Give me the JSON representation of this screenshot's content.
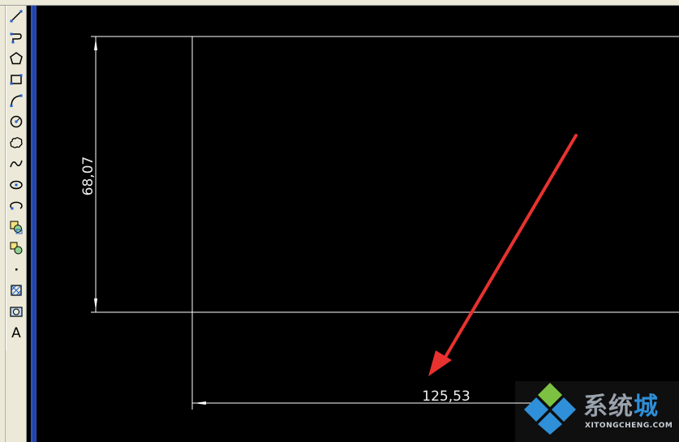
{
  "toolbar": {
    "tools": [
      {
        "name": "line-tool-icon"
      },
      {
        "name": "polyline-tool-icon"
      },
      {
        "name": "polygon-tool-icon"
      },
      {
        "name": "rectangle-tool-icon"
      },
      {
        "name": "arc-tool-icon"
      },
      {
        "name": "circle-tool-icon"
      },
      {
        "name": "revision-cloud-tool-icon"
      },
      {
        "name": "spline-tool-icon"
      },
      {
        "name": "ellipse-tool-icon"
      },
      {
        "name": "ellipse-arc-tool-icon"
      },
      {
        "name": "insert-block-tool-icon"
      },
      {
        "name": "make-block-tool-icon"
      },
      {
        "name": "point-tool-icon"
      },
      {
        "name": "hatch-tool-icon"
      },
      {
        "name": "region-tool-icon"
      },
      {
        "name": "multiline-text-tool-icon"
      }
    ],
    "text_tool_glyph": "A"
  },
  "drawing": {
    "vertical_dimension": "68,07",
    "horizontal_dimension": "125,53",
    "line_color": "#ffffff",
    "arrow_color": "#e8322f"
  },
  "watermark": {
    "chinese_text": "系统",
    "chinese_accent": "城",
    "english_text": "XITONGCHENG.COM"
  }
}
